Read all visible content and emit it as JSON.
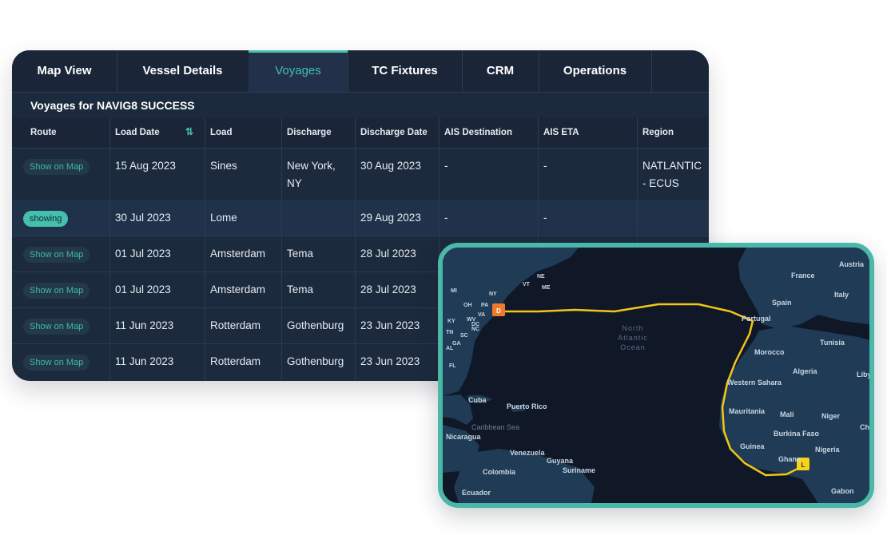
{
  "tabs": [
    {
      "label": "Map View",
      "active": false
    },
    {
      "label": "Vessel Details",
      "active": false
    },
    {
      "label": "Voyages",
      "active": true
    },
    {
      "label": "TC Fixtures",
      "active": false
    },
    {
      "label": "CRM",
      "active": false
    },
    {
      "label": "Operations",
      "active": false
    }
  ],
  "section_title": "Voyages for NAVIG8 SUCCESS",
  "columns": [
    "Route",
    "Load Date",
    "Load",
    "Discharge",
    "Discharge Date",
    "AIS Destination",
    "AIS ETA",
    "Region"
  ],
  "sort_icon": "sort-arrows-icon",
  "rows": [
    {
      "route": "Show on Map",
      "load_date": "15 Aug 2023",
      "load": "Sines",
      "discharge": "New York, NY",
      "discharge_date": "30 Aug 2023",
      "ais_destination": "-",
      "ais_eta": "-",
      "region": "NATLANTIC - ECUS"
    },
    {
      "route": "showing",
      "load_date": "30 Jul 2023",
      "load": "Lome",
      "discharge": "",
      "discharge_date": "29 Aug 2023",
      "ais_destination": "-",
      "ais_eta": "-",
      "region": ""
    },
    {
      "route": "Show on Map",
      "load_date": "01 Jul 2023",
      "load": "Amsterdam",
      "discharge": "Tema",
      "discharge_date": "28 Jul 2023",
      "ais_destination": "",
      "ais_eta": "",
      "region": ""
    },
    {
      "route": "Show on Map",
      "load_date": "01 Jul 2023",
      "load": "Amsterdam",
      "discharge": "Tema",
      "discharge_date": "28 Jul 2023",
      "ais_destination": "",
      "ais_eta": "",
      "region": ""
    },
    {
      "route": "Show on Map",
      "load_date": "11 Jun 2023",
      "load": "Rotterdam",
      "discharge": "Gothenburg",
      "discharge_date": "23 Jun 2023",
      "ais_destination": "",
      "ais_eta": "",
      "region": ""
    },
    {
      "route": "Show on Map",
      "load_date": "11 Jun 2023",
      "load": "Rotterdam",
      "discharge": "Gothenburg",
      "discharge_date": "23 Jun 2023",
      "ais_destination": "",
      "ais_eta": "",
      "region": ""
    }
  ],
  "map": {
    "ocean_label": [
      "North",
      "Atlantic",
      "Ocean"
    ],
    "origin_marker": "D",
    "destination_marker": "L",
    "route_color": "#f3c614",
    "origin_color": "#f07a2a",
    "destination_color": "#f6d21b",
    "labels": [
      "France",
      "Austria",
      "Spain",
      "Italy",
      "Portugal",
      "Morocco",
      "Tunisia",
      "Algeria",
      "Liby",
      "Western Sahara",
      "Mauritania",
      "Mali",
      "Niger",
      "Burkina Faso",
      "Guinea",
      "Ghana",
      "Nigeria",
      "Ch",
      "Gabon",
      "Cuba",
      "Puerto Rico",
      "Caribbean Sea",
      "Nicaragua",
      "Venezuela",
      "Guyana",
      "Suriname",
      "Colombia",
      "Ecuador",
      "NY",
      "MI",
      "PA",
      "DC",
      "SC",
      "GA",
      "FL",
      "NC",
      "VA",
      "WV",
      "OH",
      "KY",
      "TN",
      "AL",
      "NE",
      "ME",
      "VT"
    ]
  },
  "colors": {
    "panel": "#1c2a3d",
    "accent": "#45bfae"
  }
}
